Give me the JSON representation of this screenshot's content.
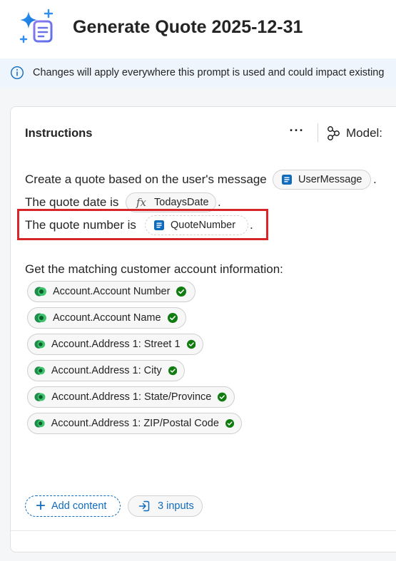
{
  "header": {
    "title": "Generate Quote 2025-12-31",
    "icon": "sparkle-document-icon"
  },
  "infobar": {
    "icon": "info-icon",
    "text": "Changes will apply everywhere this prompt is used and could impact existing"
  },
  "instructions": {
    "title": "Instructions",
    "more_label": "···",
    "model_label": "Model:",
    "line1_text": "Create a quote based on the user's message",
    "line1_chip": "UserMessage",
    "line2_text": "The quote date is",
    "line2_chip": "TodaysDate",
    "line3_text": "The quote number is",
    "line3_chip": "QuoteNumber",
    "period": ".",
    "account_intro": "Get the matching customer account information:",
    "account_fields": [
      "Account.Account Number",
      "Account.Account Name",
      "Account.Address 1: Street 1",
      "Account.Address 1: City",
      "Account.Address 1: State/Province",
      "Account.Address 1: ZIP/Postal Code"
    ]
  },
  "footer": {
    "add_content_label": "Add content",
    "inputs_label": "3 inputs"
  },
  "colors": {
    "accent": "#0f6cbd",
    "highlight": "#d7262a",
    "check": "#107c10",
    "infobar_bg": "#eef5fc"
  }
}
